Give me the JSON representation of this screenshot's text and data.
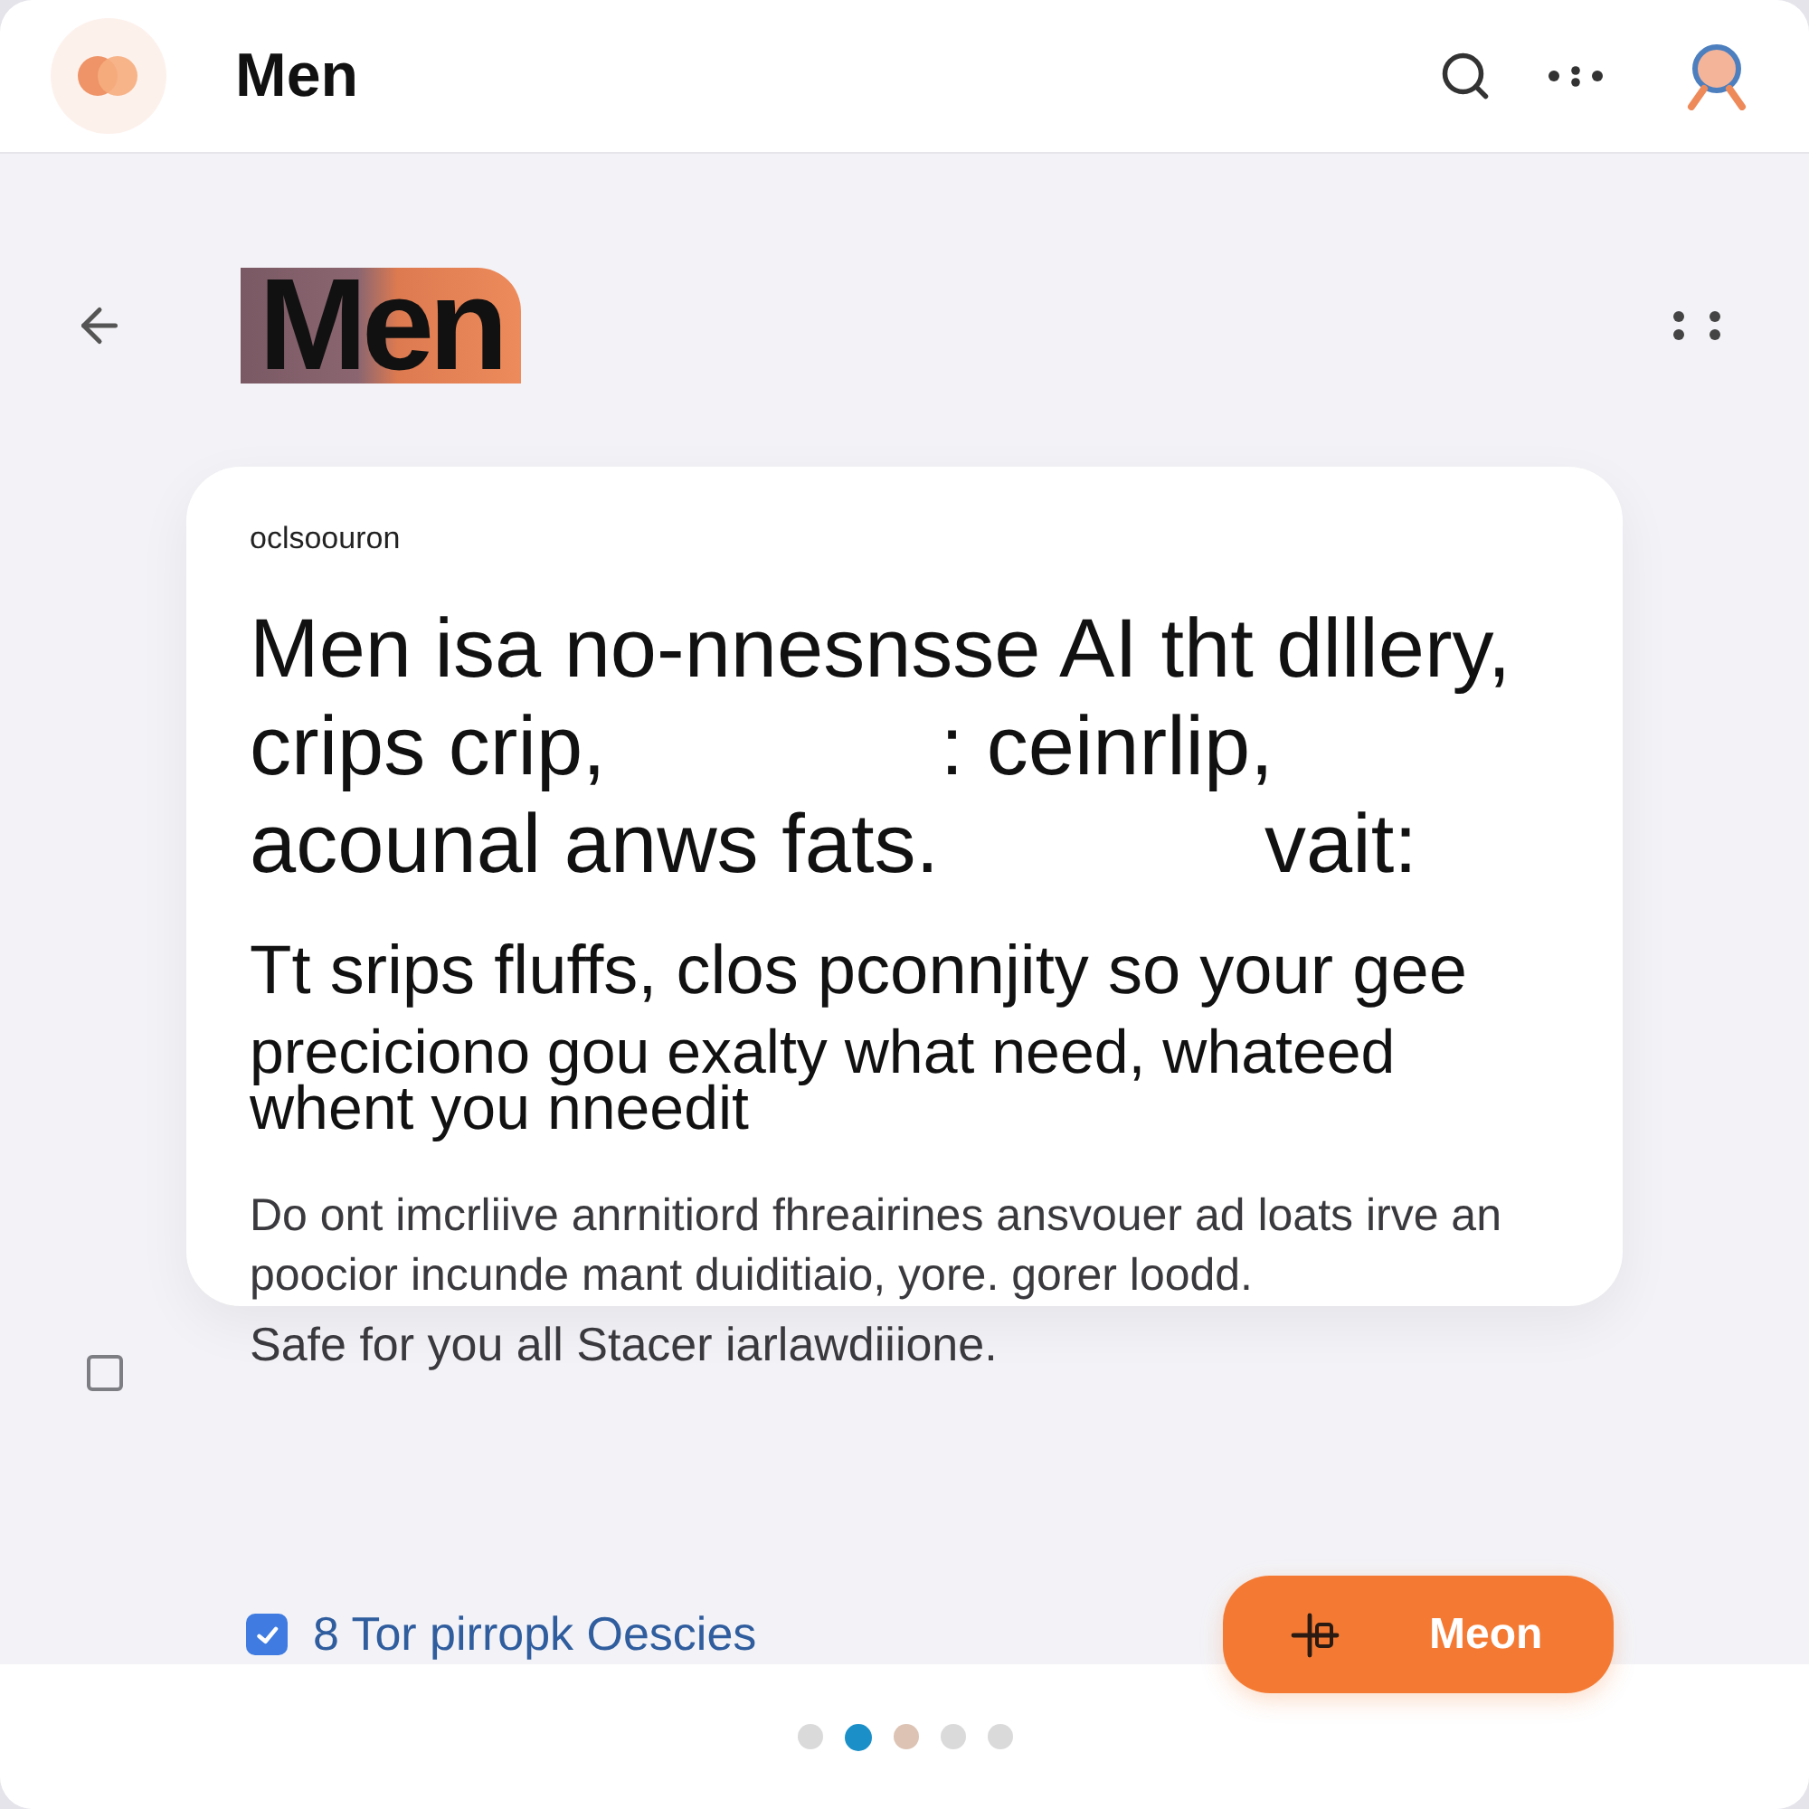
{
  "header": {
    "title": "Men"
  },
  "brand_logo": {
    "text": "Men"
  },
  "card": {
    "eyebrow": "oclsoouron",
    "headline": [
      [
        "Men isa no-nnesnsse AI tht dlllery,"
      ],
      [
        "crips crip,",
        ": ceinrlip,"
      ],
      [
        "acounal anws fats.",
        "vait:"
      ]
    ],
    "lead": "Tt srips fluffs, clos pconnjity so your gee",
    "body": [
      "preciciono gou exalty what need, whateed",
      "whent you nneedit"
    ],
    "note": [
      "Do ont imcrliive anrnitiord fhreairines ansvouer ad loats irve an",
      "poocior incunde mant duiditiaio, yore. gorer loodd."
    ]
  },
  "safety_note": "Safe for you all Stacer iarlawdiiione.",
  "side_checkbox": {
    "checked": false
  },
  "agreement": {
    "checked": true,
    "label": "8 Tor pirropk Oescies"
  },
  "primary_button": {
    "label": "Meon"
  },
  "pagination": [
    {
      "selected": false,
      "color": "#dadada"
    },
    {
      "selected": true,
      "color": "#1b8fc8"
    },
    {
      "selected": false,
      "color": "#dcc3b4"
    },
    {
      "selected": false,
      "color": "#dadada"
    },
    {
      "selected": false,
      "color": "#dadada"
    }
  ]
}
